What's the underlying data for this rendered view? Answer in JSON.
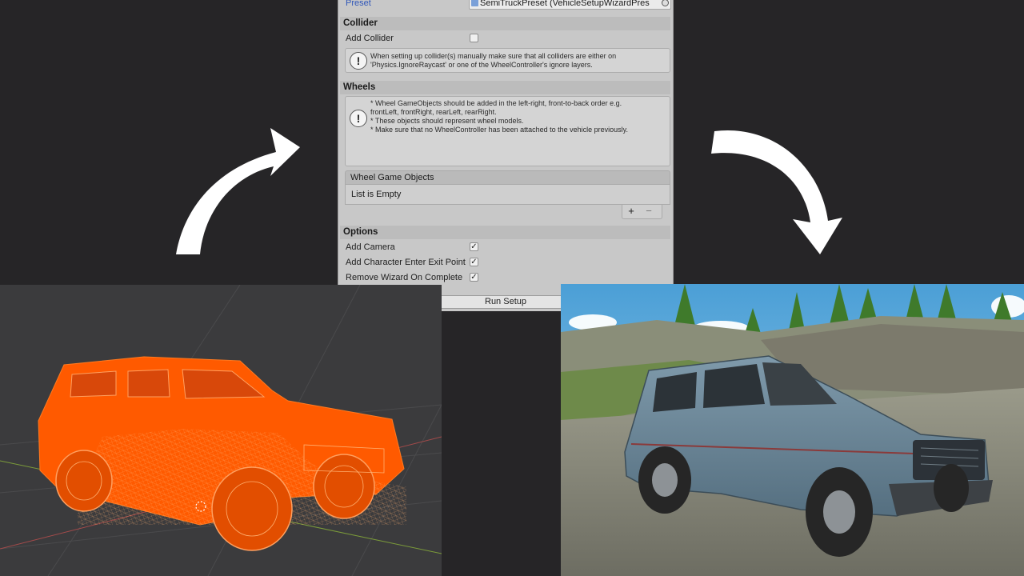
{
  "wizard": {
    "preset_label": "Preset",
    "preset_value": "SemiTruckPreset (VehicleSetupWizardPres",
    "collider": {
      "header": "Collider",
      "add_collider_label": "Add Collider",
      "add_collider_checked": false,
      "help_text": "When setting up collider(s) manually make sure that all colliders are either on\n'Physics.IgnoreRaycast' or one of the WheelController's ignore layers."
    },
    "wheels": {
      "header": "Wheels",
      "help_text": "* Wheel GameObjects should be added in the left-right, front-to-back order e.g.\nfrontLeft, frontRight, rearLeft, rearRight.\n* These objects should represent wheel models.\n* Make sure that no WheelController has been attached to the vehicle previously.",
      "list_header": "Wheel Game Objects",
      "list_empty": "List is Empty",
      "add_symbol": "+",
      "remove_symbol": "−"
    },
    "options": {
      "header": "Options",
      "add_camera_label": "Add Camera",
      "add_camera_checked": true,
      "add_character_label": "Add Character Enter Exit Point",
      "add_character_checked": true,
      "remove_wizard_label": "Remove Wizard On Complete",
      "remove_wizard_checked": true
    },
    "run_button": "Run Setup",
    "check_mark": "✓"
  },
  "images": {
    "left": "wireframe-vehicle-model",
    "right": "textured-vehicle-in-game"
  },
  "colors": {
    "background": "#262527",
    "wireframe": "#ff5a00",
    "car_body": "#6b8798",
    "sky": "#5aa6d8"
  }
}
